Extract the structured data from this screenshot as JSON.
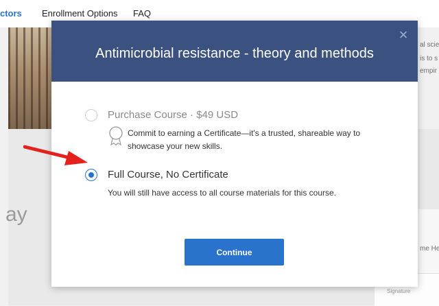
{
  "nav": {
    "items": [
      {
        "label": "ctors"
      },
      {
        "label": "Enrollment Options"
      },
      {
        "label": "FAQ"
      }
    ]
  },
  "background": {
    "heading_fragment": "ay",
    "right_text": [
      "al scien",
      "is to s",
      "empir"
    ],
    "card_fragment": "me He",
    "stamp": "Signature"
  },
  "modal": {
    "title": "Antimicrobial resistance - theory and methods",
    "close_icon": "close-icon",
    "options": [
      {
        "label": "Purchase Course · $49 USD",
        "selected": false,
        "icon": "certificate-icon",
        "description": "Commit to earning a Certificate—it's a trusted, shareable way to showcase your new skills."
      },
      {
        "label": "Full Course, No Certificate",
        "selected": true,
        "description": "You will still have access to all course materials for this course."
      }
    ],
    "continue_label": "Continue"
  },
  "annotation": {
    "arrow_color": "#e5211d"
  },
  "colors": {
    "header_bg": "#3b5280",
    "accent": "#2a73cc"
  }
}
